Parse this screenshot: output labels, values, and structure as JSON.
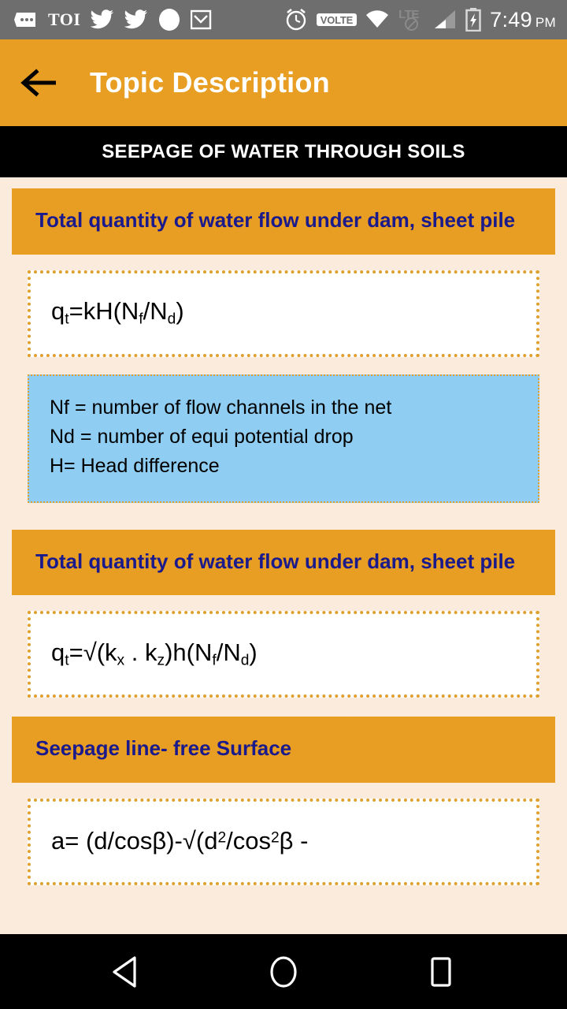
{
  "status_bar": {
    "background": "#6E6E6E",
    "left_icons": [
      {
        "name": "messages-icon",
        "label": ""
      },
      {
        "name": "toi-news-icon",
        "label": "TOI"
      },
      {
        "name": "twitter-icon-1",
        "label": ""
      },
      {
        "name": "twitter-icon-2",
        "label": ""
      },
      {
        "name": "circle-notification-icon",
        "label": ""
      },
      {
        "name": "gmail-icon",
        "label": ""
      }
    ],
    "right_icons": [
      {
        "name": "alarm-clock-icon",
        "label": ""
      },
      {
        "name": "volte-icon",
        "label": "VOLTE"
      },
      {
        "name": "wifi-icon",
        "label": ""
      },
      {
        "name": "lte-disabled-icon",
        "label": "LTE"
      },
      {
        "name": "signal-icon",
        "label": ""
      },
      {
        "name": "battery-charging-icon",
        "label": ""
      }
    ],
    "time": "7:49",
    "time_period": "PM"
  },
  "app_bar": {
    "title": "Topic Description",
    "background": "#E79E22",
    "title_color": "#FFFFFF",
    "back_icon": "back-arrow-icon"
  },
  "topic_bar": {
    "title": "SEEPAGE OF WATER THROUGH SOILS",
    "background": "#000000",
    "text_color": "#FFFFFF"
  },
  "colors": {
    "page_background": "#FAEBDC",
    "accent_orange": "#E79E22",
    "heading_text": "#1A1A8C",
    "dotted_border": "#E0A02E",
    "info_blue": "#8FCDF2"
  },
  "content": {
    "blocks": [
      {
        "type": "heading",
        "text": "Total quantity of water flow under dam, sheet pile"
      },
      {
        "type": "formula",
        "parts": [
          {
            "t": "q"
          },
          {
            "sub": "t"
          },
          {
            "t": "=kH(N"
          },
          {
            "sub": "f"
          },
          {
            "t": "/N"
          },
          {
            "sub": "d"
          },
          {
            "t": ")"
          }
        ],
        "plain": "qt=kH(Nf/Nd)"
      },
      {
        "type": "info",
        "lines": [
          "Nf = number of flow channels in the net",
          "Nd = number of equi potential drop",
          "H= Head difference"
        ]
      },
      {
        "type": "heading",
        "text": "Total quantity of water flow under dam, sheet pile"
      },
      {
        "type": "formula",
        "parts": [
          {
            "t": "q"
          },
          {
            "sub": "t"
          },
          {
            "t": "=√(k"
          },
          {
            "sub": "x"
          },
          {
            "t": " . k"
          },
          {
            "sub": "z"
          },
          {
            "t": ")h(N"
          },
          {
            "sub": "f"
          },
          {
            "t": "/N"
          },
          {
            "sub": "d"
          },
          {
            "t": ")"
          }
        ],
        "plain": "qt=√(kx . kz)h(Nf/Nd)"
      },
      {
        "type": "heading",
        "text": "Seepage line- free Surface"
      },
      {
        "type": "formula",
        "parts": [
          {
            "t": "a= (d/cosβ)-√(d"
          },
          {
            "sup": "2"
          },
          {
            "t": "/cos"
          },
          {
            "sup": "2"
          },
          {
            "t": "β -"
          }
        ],
        "plain": "a= (d/cosβ)-√(d2/cos2β -"
      }
    ]
  },
  "nav_bar": {
    "buttons": [
      {
        "name": "nav-back-button",
        "icon": "triangle-back-icon"
      },
      {
        "name": "nav-home-button",
        "icon": "circle-home-icon"
      },
      {
        "name": "nav-recents-button",
        "icon": "square-recents-icon"
      }
    ]
  }
}
